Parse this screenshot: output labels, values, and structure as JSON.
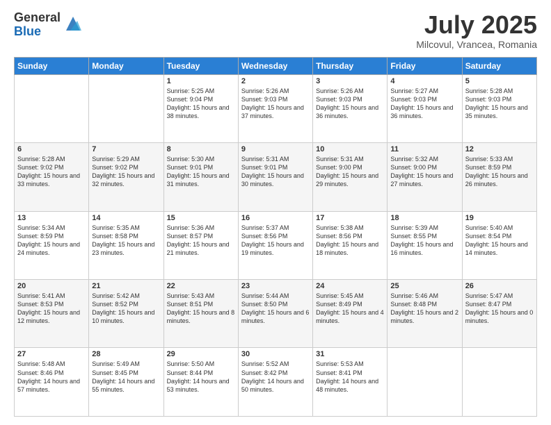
{
  "header": {
    "logo_general": "General",
    "logo_blue": "Blue",
    "title": "July 2025",
    "location": "Milcovul, Vrancea, Romania"
  },
  "days_of_week": [
    "Sunday",
    "Monday",
    "Tuesday",
    "Wednesday",
    "Thursday",
    "Friday",
    "Saturday"
  ],
  "weeks": [
    [
      {
        "day": "",
        "info": ""
      },
      {
        "day": "",
        "info": ""
      },
      {
        "day": "1",
        "info": "Sunrise: 5:25 AM\nSunset: 9:04 PM\nDaylight: 15 hours\nand 38 minutes."
      },
      {
        "day": "2",
        "info": "Sunrise: 5:26 AM\nSunset: 9:03 PM\nDaylight: 15 hours\nand 37 minutes."
      },
      {
        "day": "3",
        "info": "Sunrise: 5:26 AM\nSunset: 9:03 PM\nDaylight: 15 hours\nand 36 minutes."
      },
      {
        "day": "4",
        "info": "Sunrise: 5:27 AM\nSunset: 9:03 PM\nDaylight: 15 hours\nand 36 minutes."
      },
      {
        "day": "5",
        "info": "Sunrise: 5:28 AM\nSunset: 9:03 PM\nDaylight: 15 hours\nand 35 minutes."
      }
    ],
    [
      {
        "day": "6",
        "info": "Sunrise: 5:28 AM\nSunset: 9:02 PM\nDaylight: 15 hours\nand 33 minutes."
      },
      {
        "day": "7",
        "info": "Sunrise: 5:29 AM\nSunset: 9:02 PM\nDaylight: 15 hours\nand 32 minutes."
      },
      {
        "day": "8",
        "info": "Sunrise: 5:30 AM\nSunset: 9:01 PM\nDaylight: 15 hours\nand 31 minutes."
      },
      {
        "day": "9",
        "info": "Sunrise: 5:31 AM\nSunset: 9:01 PM\nDaylight: 15 hours\nand 30 minutes."
      },
      {
        "day": "10",
        "info": "Sunrise: 5:31 AM\nSunset: 9:00 PM\nDaylight: 15 hours\nand 29 minutes."
      },
      {
        "day": "11",
        "info": "Sunrise: 5:32 AM\nSunset: 9:00 PM\nDaylight: 15 hours\nand 27 minutes."
      },
      {
        "day": "12",
        "info": "Sunrise: 5:33 AM\nSunset: 8:59 PM\nDaylight: 15 hours\nand 26 minutes."
      }
    ],
    [
      {
        "day": "13",
        "info": "Sunrise: 5:34 AM\nSunset: 8:59 PM\nDaylight: 15 hours\nand 24 minutes."
      },
      {
        "day": "14",
        "info": "Sunrise: 5:35 AM\nSunset: 8:58 PM\nDaylight: 15 hours\nand 23 minutes."
      },
      {
        "day": "15",
        "info": "Sunrise: 5:36 AM\nSunset: 8:57 PM\nDaylight: 15 hours\nand 21 minutes."
      },
      {
        "day": "16",
        "info": "Sunrise: 5:37 AM\nSunset: 8:56 PM\nDaylight: 15 hours\nand 19 minutes."
      },
      {
        "day": "17",
        "info": "Sunrise: 5:38 AM\nSunset: 8:56 PM\nDaylight: 15 hours\nand 18 minutes."
      },
      {
        "day": "18",
        "info": "Sunrise: 5:39 AM\nSunset: 8:55 PM\nDaylight: 15 hours\nand 16 minutes."
      },
      {
        "day": "19",
        "info": "Sunrise: 5:40 AM\nSunset: 8:54 PM\nDaylight: 15 hours\nand 14 minutes."
      }
    ],
    [
      {
        "day": "20",
        "info": "Sunrise: 5:41 AM\nSunset: 8:53 PM\nDaylight: 15 hours\nand 12 minutes."
      },
      {
        "day": "21",
        "info": "Sunrise: 5:42 AM\nSunset: 8:52 PM\nDaylight: 15 hours\nand 10 minutes."
      },
      {
        "day": "22",
        "info": "Sunrise: 5:43 AM\nSunset: 8:51 PM\nDaylight: 15 hours\nand 8 minutes."
      },
      {
        "day": "23",
        "info": "Sunrise: 5:44 AM\nSunset: 8:50 PM\nDaylight: 15 hours\nand 6 minutes."
      },
      {
        "day": "24",
        "info": "Sunrise: 5:45 AM\nSunset: 8:49 PM\nDaylight: 15 hours\nand 4 minutes."
      },
      {
        "day": "25",
        "info": "Sunrise: 5:46 AM\nSunset: 8:48 PM\nDaylight: 15 hours\nand 2 minutes."
      },
      {
        "day": "26",
        "info": "Sunrise: 5:47 AM\nSunset: 8:47 PM\nDaylight: 15 hours\nand 0 minutes."
      }
    ],
    [
      {
        "day": "27",
        "info": "Sunrise: 5:48 AM\nSunset: 8:46 PM\nDaylight: 14 hours\nand 57 minutes."
      },
      {
        "day": "28",
        "info": "Sunrise: 5:49 AM\nSunset: 8:45 PM\nDaylight: 14 hours\nand 55 minutes."
      },
      {
        "day": "29",
        "info": "Sunrise: 5:50 AM\nSunset: 8:44 PM\nDaylight: 14 hours\nand 53 minutes."
      },
      {
        "day": "30",
        "info": "Sunrise: 5:52 AM\nSunset: 8:42 PM\nDaylight: 14 hours\nand 50 minutes."
      },
      {
        "day": "31",
        "info": "Sunrise: 5:53 AM\nSunset: 8:41 PM\nDaylight: 14 hours\nand 48 minutes."
      },
      {
        "day": "",
        "info": ""
      },
      {
        "day": "",
        "info": ""
      }
    ]
  ]
}
